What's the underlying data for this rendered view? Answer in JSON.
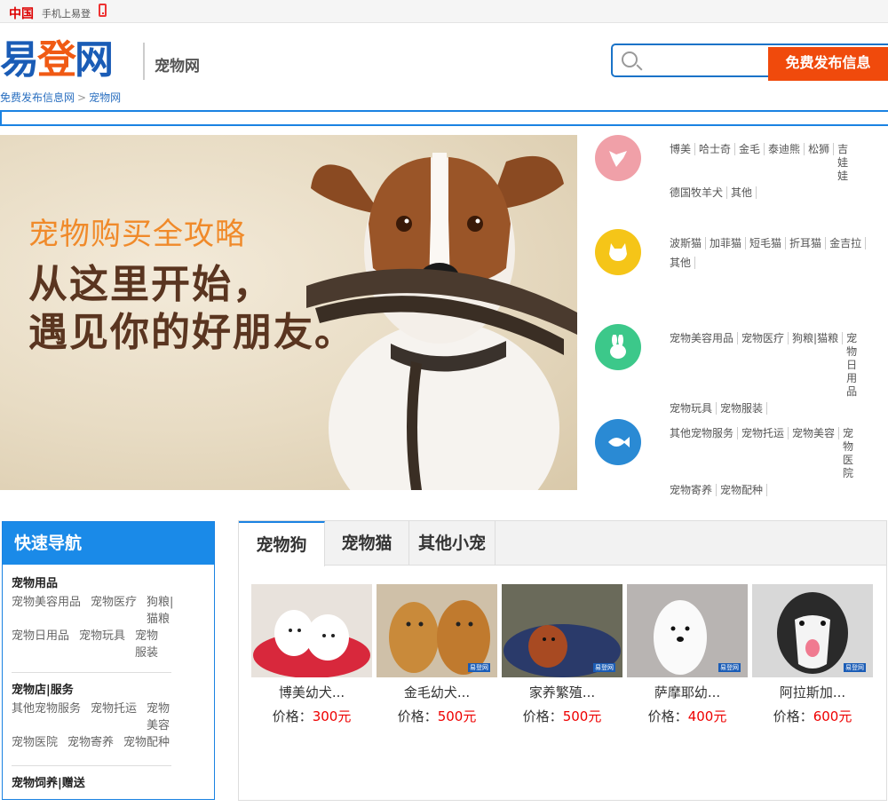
{
  "topbar": {
    "china": "中国",
    "mobile": "手机上易登"
  },
  "header": {
    "logo": {
      "c1": "易",
      "c2": "登",
      "c3": "网"
    },
    "site_name": "宠物网",
    "search_placeholder": "",
    "post_button": "免费发布信息"
  },
  "breadcrumb": {
    "home": "免费发布信息网",
    "sep": ">",
    "current": "宠物网"
  },
  "banner": {
    "line1": "宠物购买全攻略",
    "line2": "从这里开始，",
    "line3": "遇见你的好朋友。"
  },
  "categories": [
    {
      "icon": "dog-icon",
      "color": "#f0a0a8",
      "links": [
        "博美",
        "哈士奇",
        "金毛",
        "泰迪熊",
        "松狮",
        "吉娃娃",
        "德国牧羊犬",
        "其他"
      ]
    },
    {
      "icon": "cat-icon",
      "color": "#f5c518",
      "links": [
        "波斯猫",
        "加菲猫",
        "短毛猫",
        "折耳猫",
        "金吉拉",
        "其他"
      ]
    },
    {
      "icon": "rabbit-icon",
      "color": "#3cc88a",
      "links": [
        "宠物美容用品",
        "宠物医疗",
        "狗粮|猫粮",
        "宠物日用品",
        "宠物玩具",
        "宠物服装"
      ]
    },
    {
      "icon": "fish-icon",
      "color": "#2a8ad4",
      "links": [
        "其他宠物服务",
        "宠物托运",
        "宠物美容",
        "宠物医院",
        "宠物寄养",
        "宠物配种"
      ]
    }
  ],
  "quicknav": {
    "title": "快速导航",
    "sections": [
      {
        "title": "宠物用品",
        "items": [
          "宠物美容用品",
          "宠物医疗",
          "狗粮|猫粮",
          "宠物日用品",
          "宠物玩具",
          "宠物服装"
        ]
      },
      {
        "title": "宠物店|服务",
        "items": [
          "其他宠物服务",
          "宠物托运",
          "宠物美容",
          "宠物医院",
          "宠物寄养",
          "宠物配种"
        ]
      },
      {
        "title": "宠物饲养|赠送",
        "items": []
      }
    ]
  },
  "listing": {
    "tabs": [
      "宠物狗",
      "宠物猫",
      "其他小宠"
    ],
    "active_tab": 0,
    "price_label": "价格：",
    "cards": [
      {
        "name": "博美幼犬...",
        "price": "300元",
        "bg": "#e8e2dc"
      },
      {
        "name": "金毛幼犬...",
        "price": "500元",
        "bg": "#cfc0a8"
      },
      {
        "name": "家养繁殖...",
        "price": "500元",
        "bg": "#6a6a5a"
      },
      {
        "name": "萨摩耶幼...",
        "price": "400元",
        "bg": "#b8b4b2"
      },
      {
        "name": "阿拉斯加...",
        "price": "600元",
        "bg": "#d8d8d8"
      }
    ],
    "watermark": "易登网"
  }
}
